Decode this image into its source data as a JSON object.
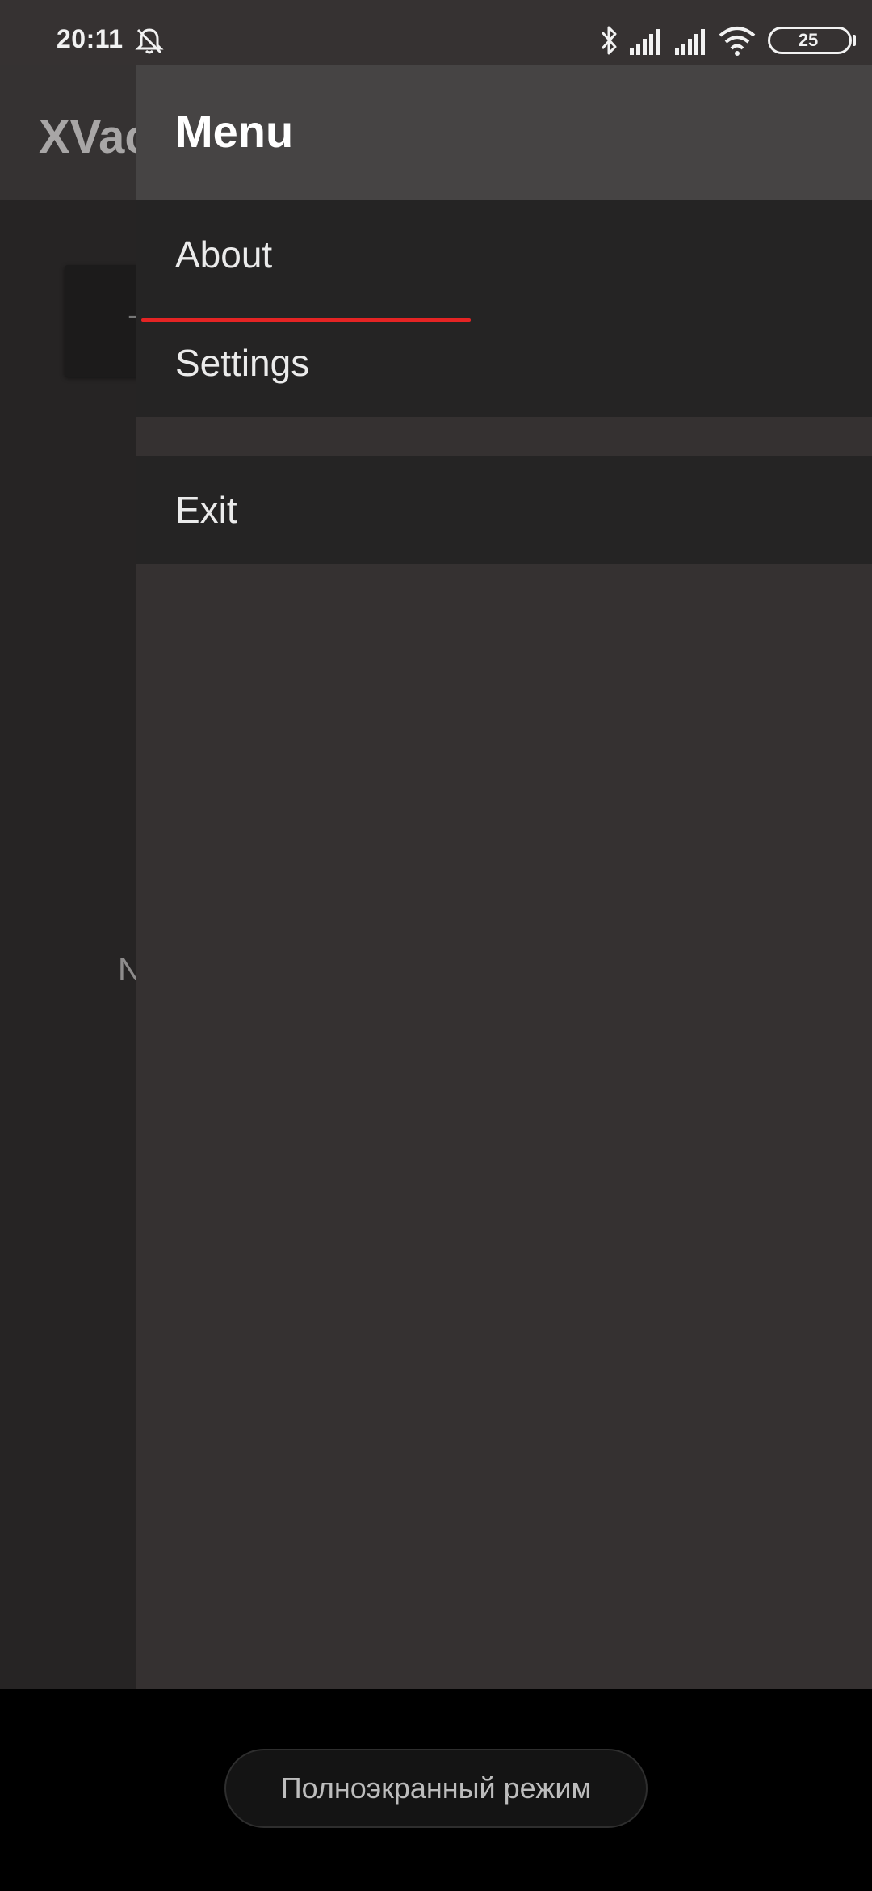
{
  "status_bar": {
    "time": "20:11",
    "battery": "25",
    "icons": [
      "muted-bell-icon",
      "bluetooth-icon",
      "signal-icon",
      "signal-icon",
      "wifi-icon",
      "battery-icon"
    ]
  },
  "app": {
    "title": "XVac",
    "card_text": "-",
    "empty_text": "N"
  },
  "drawer": {
    "title": "Menu",
    "items": [
      {
        "label": "About"
      },
      {
        "label": "Settings"
      }
    ],
    "exit_label": "Exit"
  },
  "bottom": {
    "fullscreen_label": "Полноэкранный режим"
  },
  "colors": {
    "accent": "#e52424",
    "drawer_header": "#464444",
    "drawer_bg": "#353131",
    "menu_bg": "#252424"
  }
}
